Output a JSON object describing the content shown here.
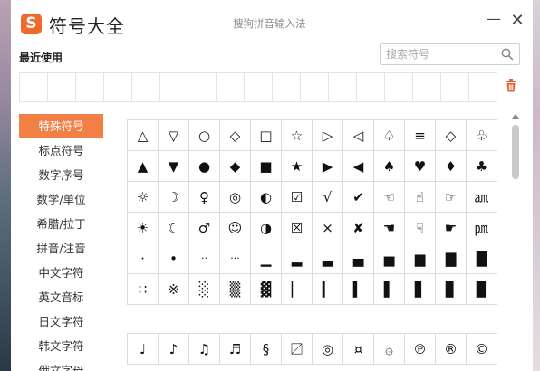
{
  "titlebar": {
    "logo_letter": "S",
    "app_title": "符号大全",
    "window_title": "搜狗拼音输入法",
    "minimize": "—",
    "close": "✕"
  },
  "recent": {
    "label": "最近使用"
  },
  "search": {
    "placeholder": "搜索符号",
    "value": ""
  },
  "categories": [
    {
      "label": "特殊符号",
      "active": true
    },
    {
      "label": "标点符号"
    },
    {
      "label": "数字序号"
    },
    {
      "label": "数学/单位"
    },
    {
      "label": "希腊/拉丁"
    },
    {
      "label": "拼音/注音"
    },
    {
      "label": "中文字符"
    },
    {
      "label": "英文音标"
    },
    {
      "label": "日文字符"
    },
    {
      "label": "韩文字符"
    },
    {
      "label": "俄文字母"
    }
  ],
  "symbols_group1": [
    [
      "△",
      "▽",
      "○",
      "◇",
      "□",
      "☆",
      "▷",
      "◁",
      "♤",
      "≡",
      "◇",
      "♧"
    ],
    [
      "▲",
      "▼",
      "●",
      "◆",
      "■",
      "★",
      "▶",
      "◀",
      "♠",
      "♥",
      "♦",
      "♣"
    ],
    [
      "☼",
      "☽",
      "♀",
      "◎",
      "◐",
      "☑",
      "√",
      "✔",
      "☜",
      "☝",
      "☞",
      "㏂"
    ],
    [
      "☀",
      "☾",
      "♂",
      "☺",
      "◑",
      "☒",
      "×",
      "✘",
      "☚",
      "☟",
      "☛",
      "㏘"
    ],
    [
      "·",
      "•",
      "··",
      "···",
      "▁",
      "▂",
      "▃",
      "▄",
      "▅",
      "▆",
      "▇",
      "█"
    ],
    [
      "∷",
      "※",
      "░",
      "▒",
      "▓",
      "▏",
      "▎",
      "▍",
      "▌",
      "▋",
      "▊",
      "▉"
    ]
  ],
  "symbols_group2": [
    [
      "♩",
      "♪",
      "♫",
      "♬",
      "§",
      "〼",
      "◎",
      "¤",
      "۞",
      "℗",
      "®",
      "©"
    ]
  ],
  "colors": {
    "accent": "#f28046",
    "logo": "#f1692a",
    "trash": "#e0643a"
  }
}
